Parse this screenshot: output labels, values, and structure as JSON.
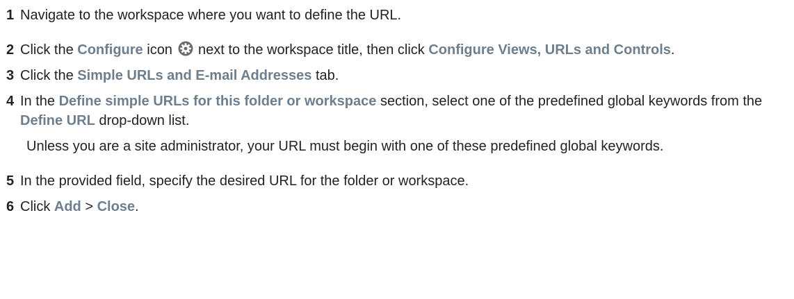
{
  "steps": [
    {
      "num": "1",
      "t1": "Navigate to the workspace where you want to define the URL."
    },
    {
      "num": "2",
      "t1": "Click the ",
      "ui1": "Configure",
      "t2": " icon ",
      "icon": "gear-icon",
      "t3": " next to the workspace title, then click ",
      "ui2": "Configure Views, URLs and Controls",
      "t4": "."
    },
    {
      "num": "3",
      "t1": "Click the ",
      "ui1": "Simple URLs and E-mail Addresses",
      "t2": " tab."
    },
    {
      "num": "4",
      "t1": "In the ",
      "ui1": "Define simple URLs for this folder or workspace",
      "t2": " section, select one of the predefined global keywords from the ",
      "ui2": "Define URL",
      "t3": " drop-down list.",
      "note": "Unless you are a site administrator, your URL must begin with one of these predefined global keywords."
    },
    {
      "num": "5",
      "t1": "In the provided field, specify the desired URL for the folder or workspace."
    },
    {
      "num": "6",
      "t1": "Click ",
      "ui1": "Add",
      "t2": " > ",
      "ui2": "Close",
      "t3": "."
    }
  ],
  "colors": {
    "ui_label": "#6e7e8c",
    "text": "#222222"
  }
}
